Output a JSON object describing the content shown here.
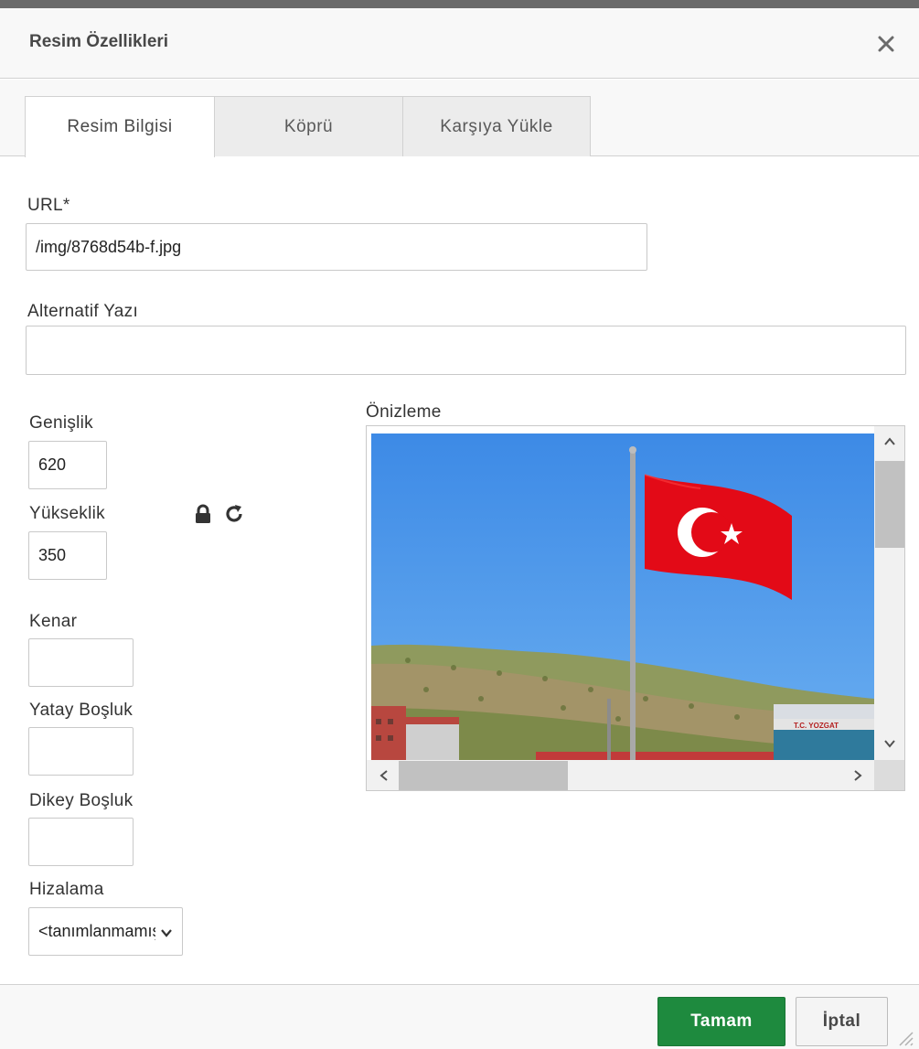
{
  "dialog": {
    "title": "Resim Özellikleri",
    "close_icon": "close-icon"
  },
  "tabs": [
    {
      "label": "Resim Bilgisi",
      "active": true
    },
    {
      "label": "Köprü",
      "active": false
    },
    {
      "label": "Karşıya Yükle",
      "active": false
    }
  ],
  "form": {
    "url_label": "URL*",
    "url_value": "/img/8768d54b-f.jpg",
    "alt_label": "Alternatif Yazı",
    "alt_value": "",
    "width_label": "Genişlik",
    "width_value": "620",
    "height_label": "Yükseklik",
    "height_value": "350",
    "lock_icon": "lock-icon",
    "reset_icon": "reset-size-icon",
    "border_label": "Kenar",
    "border_value": "",
    "hspace_label": "Yatay Boşluk",
    "hspace_value": "",
    "vspace_label": "Dikey Boşluk",
    "vspace_value": "",
    "align_label": "Hizalama",
    "align_value": "<tanımlanmamış>"
  },
  "preview": {
    "label": "Önizleme",
    "sign_text": "T.C. YOZGAT"
  },
  "footer": {
    "ok_label": "Tamam",
    "cancel_label": "İptal"
  },
  "colors": {
    "ok_button": "#1e8a3e",
    "sky": "#4f95e8",
    "flag_red": "#e30a17"
  }
}
